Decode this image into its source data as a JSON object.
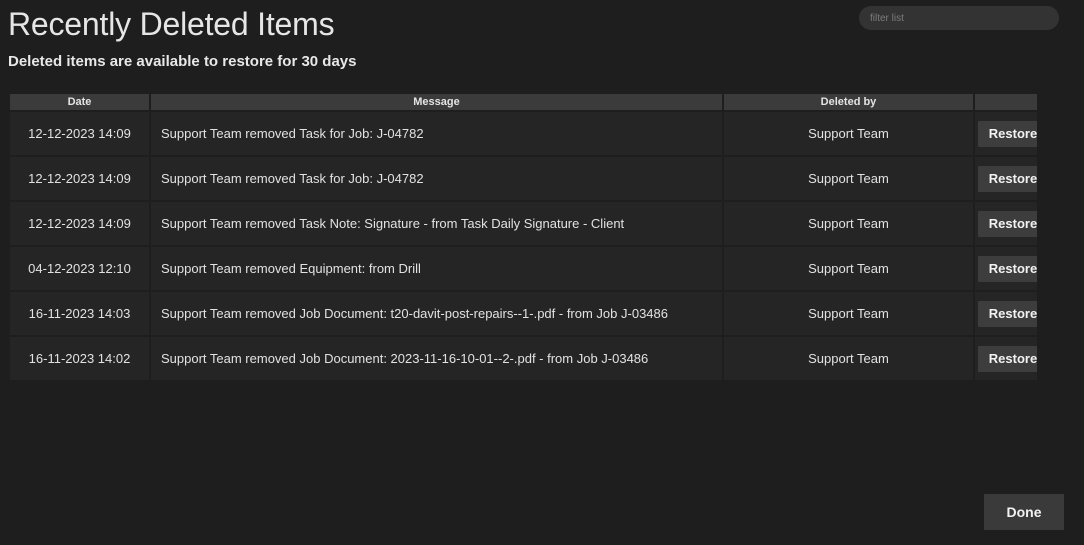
{
  "page": {
    "title": "Recently Deleted Items",
    "subtitle": "Deleted items are available to restore for 30 days"
  },
  "filter": {
    "placeholder": "filter list",
    "value": ""
  },
  "table": {
    "columns": [
      "Date",
      "Message",
      "Deleted by",
      ""
    ],
    "rows": [
      {
        "date": "12-12-2023 14:09",
        "message": "Support Team removed Task for Job: J-04782",
        "deleted_by": "Support Team",
        "action": "Restore"
      },
      {
        "date": "12-12-2023 14:09",
        "message": "Support Team removed Task for Job: J-04782",
        "deleted_by": "Support Team",
        "action": "Restore"
      },
      {
        "date": "12-12-2023 14:09",
        "message": "Support Team removed Task Note: Signature - from Task Daily Signature - Client",
        "deleted_by": "Support Team",
        "action": "Restore"
      },
      {
        "date": "04-12-2023 12:10",
        "message": "Support Team removed Equipment: from Drill",
        "deleted_by": "Support Team",
        "action": "Restore"
      },
      {
        "date": "16-11-2023 14:03",
        "message": "Support Team removed Job Document: t20-davit-post-repairs--1-.pdf - from Job J-03486",
        "deleted_by": "Support Team",
        "action": "Restore"
      },
      {
        "date": "16-11-2023 14:02",
        "message": "Support Team removed Job Document: 2023-11-16-10-01--2-.pdf - from Job J-03486",
        "deleted_by": "Support Team",
        "action": "Restore"
      }
    ]
  },
  "footer": {
    "done_label": "Done"
  },
  "colors": {
    "background": "#1e1e1e",
    "row_background": "#252525",
    "header_background": "#3b3b3b",
    "button_background": "#3d3d3d",
    "text": "#e2e2e2"
  }
}
